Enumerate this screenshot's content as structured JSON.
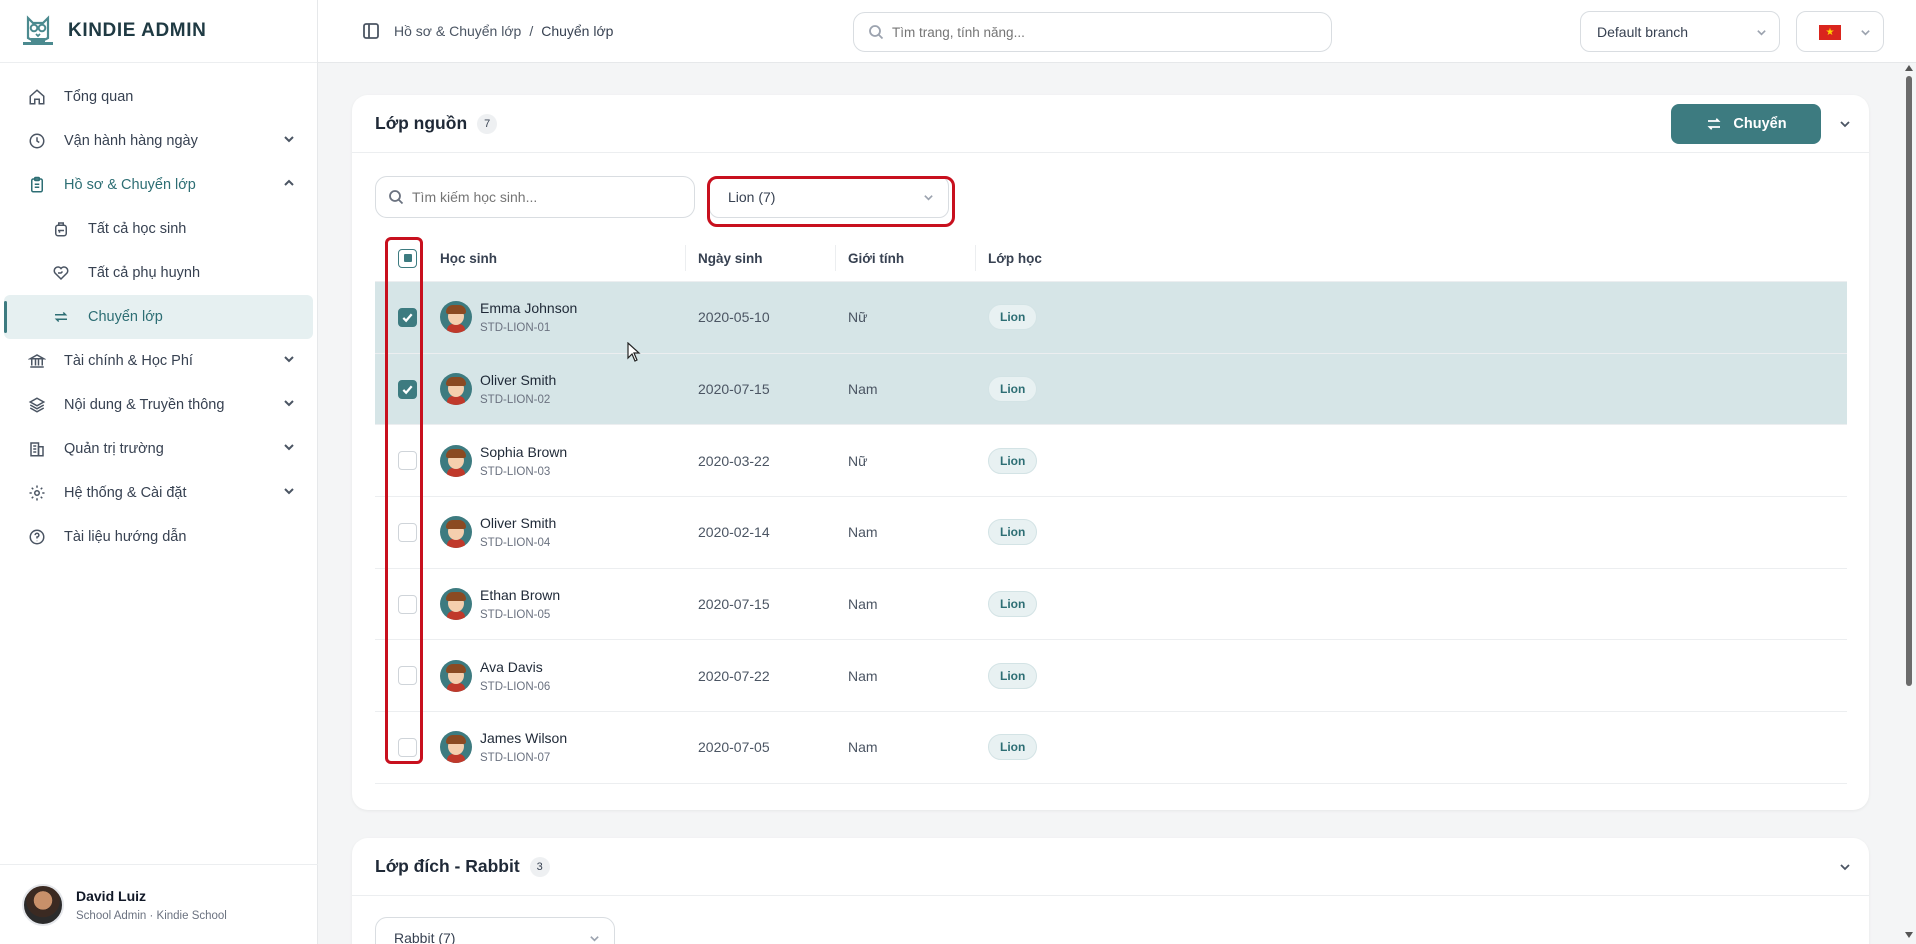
{
  "brand": {
    "name": "KINDIE ADMIN"
  },
  "sidebar": {
    "items": [
      {
        "label": "Tổng quan",
        "icon": "home-icon"
      },
      {
        "label": "Vận hành hàng ngày",
        "icon": "clock-icon"
      },
      {
        "label": "Hồ sơ & Chuyển lớp",
        "icon": "clipboard-icon"
      },
      {
        "label": "Tài chính & Học Phí",
        "icon": "bank-icon"
      },
      {
        "label": "Nội dung & Truyền thông",
        "icon": "layers-icon"
      },
      {
        "label": "Quản trị trường",
        "icon": "building-icon"
      },
      {
        "label": "Hệ thống & Cài đặt",
        "icon": "gear-icon"
      },
      {
        "label": "Tài liệu hướng dẫn",
        "icon": "help-circle-icon"
      }
    ],
    "sub_items": [
      {
        "label": "Tất cả học sinh",
        "icon": "backpack-icon"
      },
      {
        "label": "Tất cả phụ huynh",
        "icon": "heart-hand-icon"
      },
      {
        "label": "Chuyển lớp",
        "icon": "transfer-icon"
      }
    ],
    "user": {
      "name": "David Luiz",
      "role": "School Admin · Kindie School"
    }
  },
  "topbar": {
    "breadcrumb": [
      "Hồ sơ & Chuyển lớp",
      "/",
      "Chuyển lớp"
    ],
    "search_placeholder": "Tìm trang, tính năng...",
    "branch": "Default branch"
  },
  "source": {
    "title": "Lớp nguồn",
    "count": "7",
    "move_label": "Chuyển",
    "search_placeholder": "Tìm kiếm học sinh...",
    "class_select": "Lion (7)",
    "columns": [
      "Học sinh",
      "Ngày sinh",
      "Giới tính",
      "Lớp học"
    ],
    "rows": [
      {
        "name": "Emma Johnson",
        "id": "STD-LION-01",
        "dob": "2020-05-10",
        "gender": "Nữ",
        "class": "Lion",
        "checked": true
      },
      {
        "name": "Oliver Smith",
        "id": "STD-LION-02",
        "dob": "2020-07-15",
        "gender": "Nam",
        "class": "Lion",
        "checked": true
      },
      {
        "name": "Sophia Brown",
        "id": "STD-LION-03",
        "dob": "2020-03-22",
        "gender": "Nữ",
        "class": "Lion",
        "checked": false
      },
      {
        "name": "Oliver Smith",
        "id": "STD-LION-04",
        "dob": "2020-02-14",
        "gender": "Nam",
        "class": "Lion",
        "checked": false
      },
      {
        "name": "Ethan Brown",
        "id": "STD-LION-05",
        "dob": "2020-07-15",
        "gender": "Nam",
        "class": "Lion",
        "checked": false
      },
      {
        "name": "Ava Davis",
        "id": "STD-LION-06",
        "dob": "2020-07-22",
        "gender": "Nam",
        "class": "Lion",
        "checked": false
      },
      {
        "name": "James Wilson",
        "id": "STD-LION-07",
        "dob": "2020-07-05",
        "gender": "Nam",
        "class": "Lion",
        "checked": false
      }
    ]
  },
  "target": {
    "title": "Lớp đích - Rabbit",
    "count": "3",
    "class_select": "Rabbit (7)"
  },
  "colors": {
    "accent": "#3d7b80",
    "highlight": "#c8101e",
    "selected_row": "#d6e5e7"
  }
}
